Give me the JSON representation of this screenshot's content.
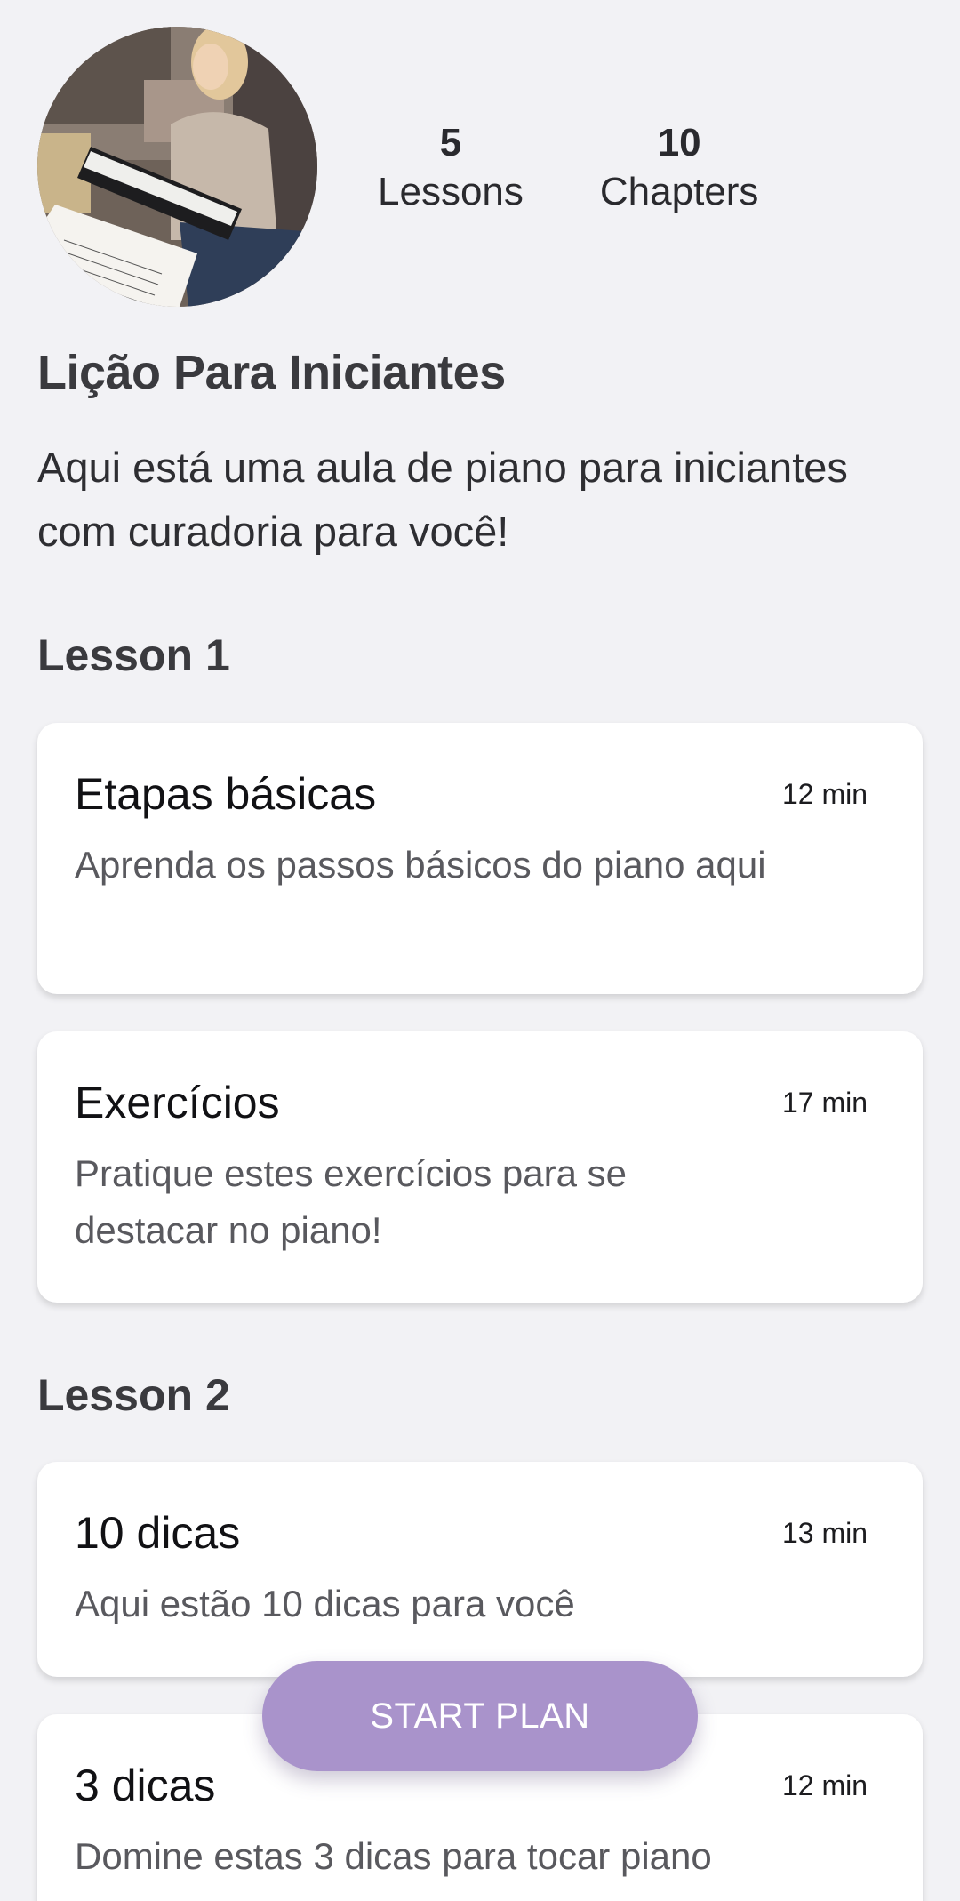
{
  "profile": {
    "image": "woman-playing-piano-photo"
  },
  "stats": [
    {
      "value": "5",
      "label": "Lessons"
    },
    {
      "value": "10",
      "label": "Chapters"
    }
  ],
  "plan": {
    "title": "Lição Para Iniciantes",
    "description": "Aqui está uma aula de piano para iniciantes com curadoria para você!"
  },
  "sections": [
    {
      "label": "Lesson 1",
      "items": [
        {
          "title": "Etapas básicas",
          "duration": "12 min",
          "description": "Aprenda os passos básicos do piano aqui"
        },
        {
          "title": "Exercícios",
          "duration": "17 min",
          "description": "Pratique estes exercícios para se destacar no piano!"
        }
      ]
    },
    {
      "label": "Lesson 2",
      "items": [
        {
          "title": "10 dicas",
          "duration": "13 min",
          "description": "Aqui estão 10 dicas para você"
        },
        {
          "title": "3 dicas",
          "duration": "12 min",
          "description": "Domine estas 3 dicas para tocar piano"
        }
      ]
    }
  ],
  "cta": {
    "label": "START PLAN"
  },
  "colors": {
    "background": "#f2f2f5",
    "card": "#ffffff",
    "accent": "#a993cb"
  }
}
